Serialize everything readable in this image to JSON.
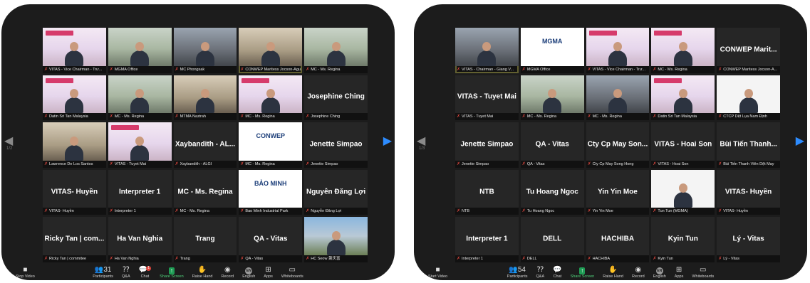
{
  "windows": [
    {
      "id": "left",
      "page_indicator": "1/2",
      "tiles": [
        {
          "label": "VITAS - Vice Chairman - Trư...",
          "video": "slide",
          "person": true,
          "banner": true
        },
        {
          "label": "MGMA Office",
          "video": "office",
          "person": true
        },
        {
          "label": "MC Phongsak",
          "video": "room",
          "person": true
        },
        {
          "label": "CONWEP Maritess Jocson-Agu...",
          "video": "home",
          "person": true,
          "active": true
        },
        {
          "label": "MC - Ms. Regina",
          "video": "office",
          "person": true
        },
        {
          "label": "Datin Sri Tan Malaysia",
          "video": "slide",
          "person": true,
          "banner": true
        },
        {
          "label": "MC - Ms. Regina",
          "video": "office",
          "person": true
        },
        {
          "label": "MTMA Nazirah",
          "video": "home",
          "person": true
        },
        {
          "label": "MC - Ms. Regina",
          "video": "slide",
          "person": true,
          "banner": true
        },
        {
          "name": "Josephine Ching",
          "label": "Josephine Ching"
        },
        {
          "label": "Lawrence De Los Santos",
          "video": "home",
          "person": true
        },
        {
          "label": "VITAS - Tuyet Mai",
          "video": "slide",
          "person": true,
          "banner": true
        },
        {
          "name": "Xaybandith - AL...",
          "label": "Xaybandith - ALGI"
        },
        {
          "label": "MC - Ms. Regina",
          "video": "logo",
          "logo_text": "CONWEP"
        },
        {
          "name": "Jenette Simpao",
          "label": "Jenette Simpao"
        },
        {
          "name": "VITAS- Huyền",
          "label": "VITAS- Huyền"
        },
        {
          "name": "Interpreter 1",
          "label": "Interpreter 1"
        },
        {
          "name": "MC - Ms. Regina",
          "label": "MC - Ms. Regina"
        },
        {
          "label": "Bao Minh Industrial Park",
          "video": "logo",
          "logo_text": "BẢO MINH"
        },
        {
          "name": "Nguyễn Đăng Lợi",
          "label": "Nguyễn Đăng Lợi"
        },
        {
          "name": "Ricky Tan | com...",
          "label": "Ricky Tan | commitee"
        },
        {
          "name": "Ha Van Nghia",
          "label": "Ha Van Nghia"
        },
        {
          "name": "Trang",
          "label": "Trang"
        },
        {
          "name": "QA - Vitas",
          "label": "QA - Vitas"
        },
        {
          "label": "HC Seow 萧庆富",
          "video": "outdoor",
          "person": true
        }
      ],
      "toolbar": {
        "video_label": "Stop Video",
        "participants_count": "31",
        "chat_badge": "1",
        "items": [
          "Participants",
          "Q&A",
          "Chat",
          "Share Screen",
          "Raise Hand",
          "Record",
          "English",
          "Apps",
          "Whiteboards"
        ]
      }
    },
    {
      "id": "right",
      "page_indicator": "1/3",
      "tiles": [
        {
          "label": "VITAS - Chairman - Giang V...",
          "video": "room",
          "person": true,
          "active": true
        },
        {
          "label": "MGMA Office",
          "video": "logo",
          "logo_text": "MGMA"
        },
        {
          "label": "VITAS - Vice Chairman - Trư...",
          "video": "slide",
          "person": true,
          "banner": true
        },
        {
          "label": "MC - Ms. Regina",
          "video": "slide",
          "person": true,
          "banner": true
        },
        {
          "name": "CONWEP Marit...",
          "label": "CONWEP Maritess Jocson-A..."
        },
        {
          "name": "VITAS - Tuyet Mai",
          "label": "VITAS - Tuyet Mai"
        },
        {
          "label": "MC - Ms. Regina",
          "video": "office",
          "person": true
        },
        {
          "label": "MC - Ms. Regina",
          "video": "room",
          "person": true
        },
        {
          "label": "Datin Sri Tan Malaysia",
          "video": "slide",
          "person": true,
          "banner": true
        },
        {
          "label": "CTCP Dệt Lụa Nam Định",
          "video": "white",
          "person": true
        },
        {
          "name": "Jenette Simpao",
          "label": "Jenette Simpao"
        },
        {
          "name": "QA - Vitas",
          "label": "QA - Vitas"
        },
        {
          "name": "Cty Cp May Son...",
          "label": "Cty Cp May Song Hong"
        },
        {
          "name": "VITAS - Hoai Son",
          "label": "VITAS - Hoai Son"
        },
        {
          "name": "Bùi Tiến Thanh...",
          "label": "Bùi Tiến Thanh Viên Dệt May"
        },
        {
          "name": "NTB",
          "label": "NTB"
        },
        {
          "name": "Tu Hoang Ngoc",
          "label": "Tu Hoang Ngoc"
        },
        {
          "name": "Yin Yin Moe",
          "label": "Yin Yin Moe"
        },
        {
          "label": "Tun Tun (MGMA)",
          "video": "white",
          "person": true
        },
        {
          "name": "VITAS- Huyền",
          "label": "VITAS- Huyền"
        },
        {
          "name": "Interpreter 1",
          "label": "Interpreter 1"
        },
        {
          "name": "DELL",
          "label": "DELL"
        },
        {
          "name": "HACHIBA",
          "label": "HACHIBA"
        },
        {
          "name": "Kyin Tun",
          "label": "Kyin Tun"
        },
        {
          "name": "Lý - Vitas",
          "label": "Lý - Vitas"
        }
      ],
      "toolbar": {
        "video_label": "Start Video",
        "participants_count": "54",
        "chat_badge": "",
        "items": [
          "Participants",
          "Q&A",
          "Chat",
          "Share Screen",
          "Raise Hand",
          "Record",
          "English",
          "Apps",
          "Whiteboards"
        ]
      }
    }
  ],
  "icons": {
    "mic_muted": "✗",
    "video": "■",
    "participants": "👥",
    "qa": "⁇",
    "chat": "💬",
    "share_screen": "↑",
    "raise_hand": "✋",
    "record": "◉",
    "english": "EN",
    "apps": "⊞",
    "whiteboards": "▭",
    "arrow_left": "◀",
    "arrow_right": "▶"
  },
  "colors": {
    "active_border": "#d9d46a",
    "share_green": "#1f9d55",
    "muted_red": "#e0473e",
    "next_arrow_blue": "#2d8cff"
  }
}
